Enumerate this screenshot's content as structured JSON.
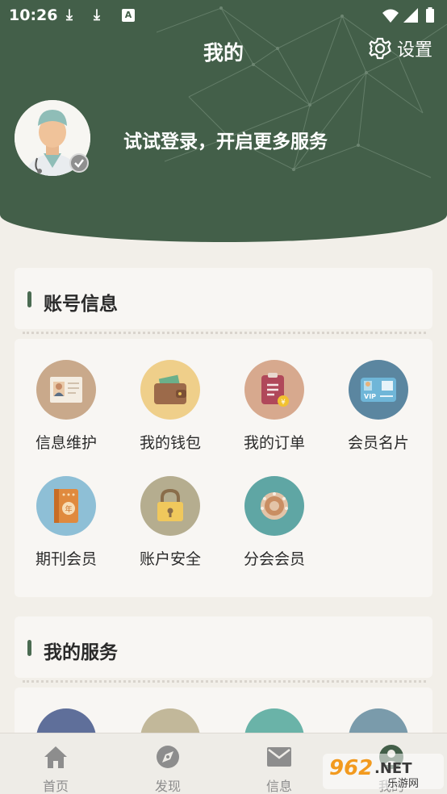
{
  "status_bar": {
    "time": "10:26",
    "icons": [
      "download-icon",
      "download-icon",
      "text-icon",
      "wifi-icon",
      "signal-icon",
      "battery-icon"
    ]
  },
  "header": {
    "title": "我的",
    "settings_label": "设置",
    "login_prompt": "试试登录，开启更多服务"
  },
  "account_section": {
    "title": "账号信息",
    "items": [
      {
        "label": "信息维护",
        "icon": "id-card-icon",
        "color": "#c9a98b"
      },
      {
        "label": "我的钱包",
        "icon": "wallet-icon",
        "color": "#efcf8a"
      },
      {
        "label": "我的订单",
        "icon": "order-icon",
        "color": "#d7a98e"
      },
      {
        "label": "会员名片",
        "icon": "vip-card-icon",
        "color": "#5b86a0"
      },
      {
        "label": "期刊会员",
        "icon": "journal-icon",
        "color": "#8ebfd6"
      },
      {
        "label": "账户安全",
        "icon": "lock-icon",
        "color": "#b5ad8f"
      },
      {
        "label": "分会会员",
        "icon": "branch-icon",
        "color": "#5fa6a4"
      }
    ]
  },
  "service_section": {
    "title": "我的服务"
  },
  "bottom_nav": [
    {
      "label": "首页",
      "icon": "home-icon"
    },
    {
      "label": "发现",
      "icon": "discover-icon"
    },
    {
      "label": "信息",
      "icon": "mail-icon"
    },
    {
      "label": "我的",
      "icon": "profile-icon"
    }
  ],
  "watermark": {
    "text": "962.NET",
    "subtext": "乐游网"
  }
}
